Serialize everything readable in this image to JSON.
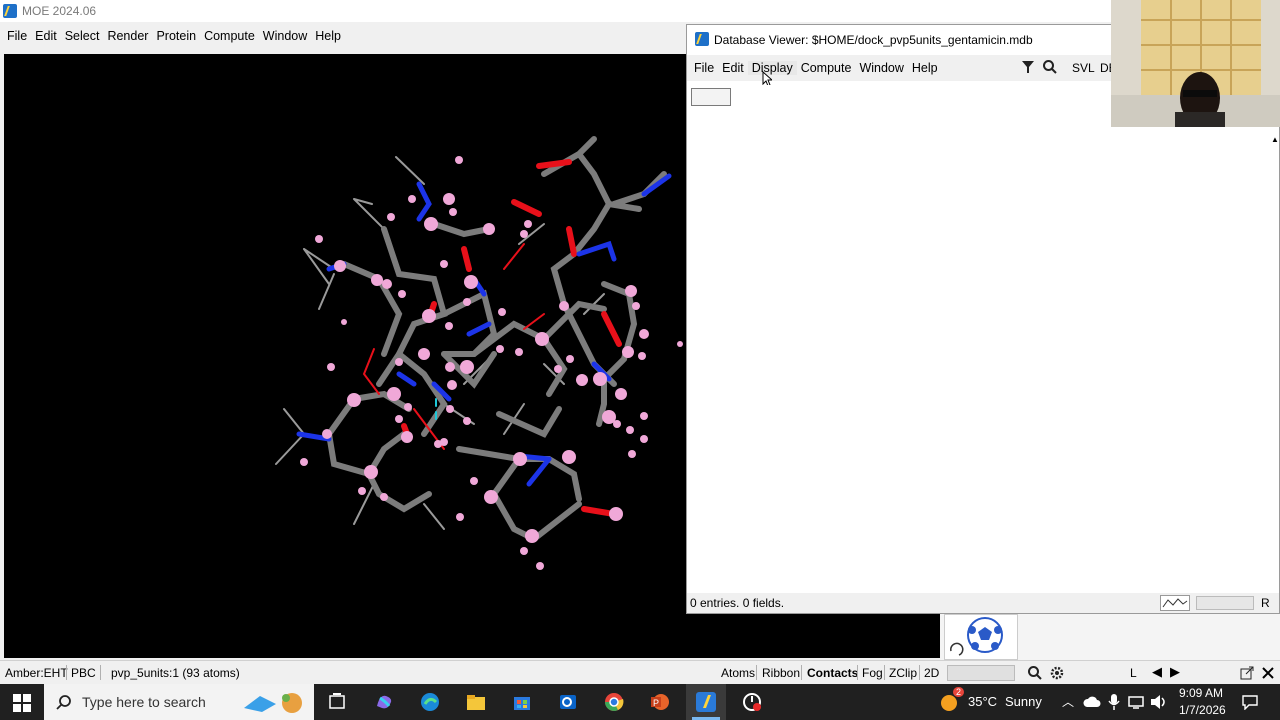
{
  "moe": {
    "title": "MOE 2024.06",
    "menu": [
      "File",
      "Edit",
      "Select",
      "Render",
      "Protein",
      "Compute",
      "Window",
      "Help"
    ]
  },
  "status": {
    "forcefield": "Amber:EHT",
    "pbc": "PBC",
    "system": "pvp_5units:1 (93 atoms)",
    "buttons": [
      "Atoms",
      "Ribbon",
      "Contacts",
      "Fog",
      "ZClip",
      "2D"
    ],
    "l_label": "L"
  },
  "dbv": {
    "title": "Database Viewer: $HOME/dock_pvp5units_gentamicin.mdb",
    "menu": [
      "File",
      "Edit",
      "Display",
      "Compute",
      "Window",
      "Help"
    ],
    "svl": "SVL",
    "de": "DE",
    "entries": "0 entries. 0 fields.",
    "r_label": "R"
  },
  "taskbar": {
    "search_placeholder": "Type here to search",
    "weather_badge": "2",
    "temperature": "35°C",
    "weather": "Sunny",
    "time": "9:09 AM",
    "date": "1/7/2026"
  },
  "colors": {
    "carbon": "#7c7c7c",
    "oxygen": "#e8101a",
    "nitrogen": "#1c34e8",
    "hydrogen": "#f0a8d8",
    "taskbar": "#202020"
  }
}
